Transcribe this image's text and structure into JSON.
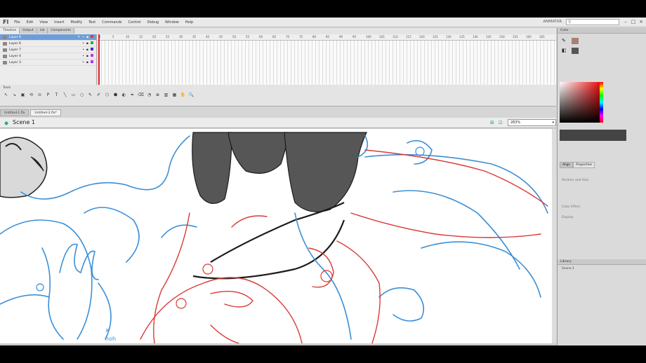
{
  "app": {
    "logo": "Fl",
    "workspace": "ANIMATOR",
    "search_placeholder": "",
    "menu": [
      "File",
      "Edit",
      "View",
      "Insert",
      "Modify",
      "Text",
      "Commands",
      "Control",
      "Debug",
      "Window",
      "Help"
    ]
  },
  "timeline": {
    "tabs": [
      "Timeline",
      "Output",
      "Lib",
      "Components"
    ],
    "layers": [
      {
        "name": "Layer 8",
        "selected": true,
        "color": "#e33"
      },
      {
        "name": "Layer 6",
        "selected": false,
        "color": "#3a3"
      },
      {
        "name": "Layer 7",
        "selected": false,
        "color": "#33c"
      },
      {
        "name": "Layer 4",
        "selected": false,
        "color": "#c3c"
      },
      {
        "name": "Layer 3",
        "selected": false,
        "color": "#a3f"
      }
    ],
    "frame_numbers": [
      "1",
      "5",
      "10",
      "15",
      "20",
      "25",
      "30",
      "35",
      "40",
      "45",
      "50",
      "55",
      "60",
      "65",
      "70",
      "75",
      "80",
      "85",
      "90",
      "95",
      "100",
      "105",
      "110",
      "115",
      "120",
      "125",
      "130",
      "135",
      "140",
      "145",
      "150",
      "155",
      "160",
      "165"
    ]
  },
  "tools_panel": {
    "label": "Tools",
    "tools": [
      "↖",
      "↘",
      "▣",
      "⟲",
      "⊙",
      "P",
      "T",
      "╲",
      "▭",
      "○",
      "✎",
      "✐",
      "⬡",
      "⬢",
      "◐",
      "✒",
      "⌫",
      "◔",
      "⊕",
      "▥",
      "▦",
      "✋",
      "🔍"
    ]
  },
  "documents": {
    "tabs": [
      {
        "name": "Untitled-1.fla",
        "active": false
      },
      {
        "name": "Untitled-2.fla*",
        "active": true
      }
    ]
  },
  "scene": {
    "label": "Scene 1",
    "zoom": "283%"
  },
  "right_panel": {
    "color_tab": "Color",
    "hex": "",
    "props_tabs": [
      "Align",
      "Properties"
    ],
    "prop_rows": [
      "Position and Size",
      "Color Effect",
      "Display"
    ],
    "library_tab": "Library",
    "library_item": "Scene 1"
  },
  "colors": {
    "blue_sketch": "#3b8fd6",
    "red_sketch": "#d83a35",
    "dark_fill": "#565656",
    "line": "#1c1c1c"
  }
}
